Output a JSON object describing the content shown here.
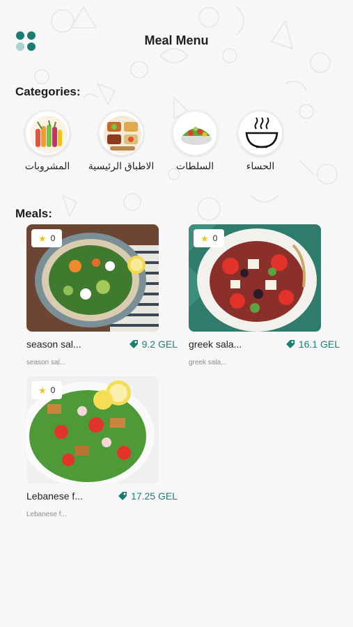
{
  "header": {
    "title": "Meal Menu",
    "menu_icon": "grid-menu-icon"
  },
  "colors": {
    "accent": "#1c7d72",
    "menu_dots": [
      "#1c7d72",
      "#1c7d72",
      "#a6d4cf",
      "#1c7d72"
    ],
    "star": "#f2c21b"
  },
  "categories": {
    "title": "Categories:",
    "items": [
      {
        "label": "المشروبات",
        "icon": "drinks-icon"
      },
      {
        "label": "الاطباق الرئيسية",
        "icon": "main-dishes-icon"
      },
      {
        "label": "السلطات",
        "icon": "salads-icon"
      },
      {
        "label": "الحساء",
        "icon": "soup-icon"
      }
    ]
  },
  "meals": {
    "title": "Meals:",
    "items": [
      {
        "name": "season sal...",
        "price": "9.2 GEL",
        "rating": "0",
        "description": "season sal...",
        "photo": "season-salad-photo"
      },
      {
        "name": "greek sala...",
        "price": "16.1 GEL",
        "rating": "0",
        "description": "greek sala...",
        "photo": "greek-salad-photo"
      },
      {
        "name": "Lebanese f...",
        "price": "17.25 GEL",
        "rating": "0",
        "description": "Lebanese f...",
        "photo": "lebanese-fattoush-photo"
      }
    ]
  }
}
